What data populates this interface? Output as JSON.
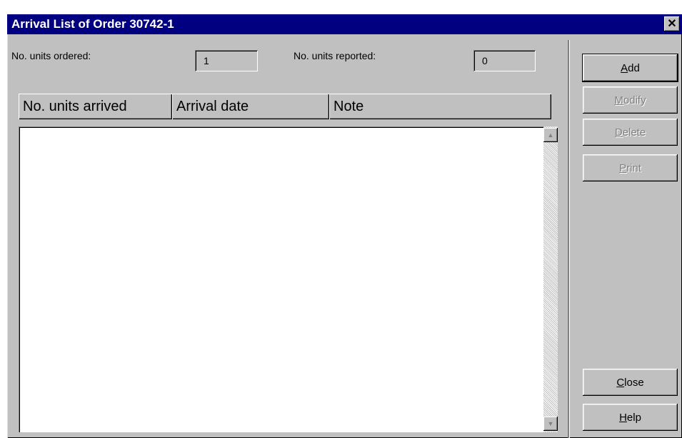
{
  "window": {
    "title": "Arrival List of Order 30742-1",
    "close_glyph": "✕"
  },
  "fields": {
    "units_ordered_label": "No. units ordered:",
    "units_ordered_value": "1",
    "units_reported_label": "No. units reported:",
    "units_reported_value": "0"
  },
  "list": {
    "columns": [
      "No. units arrived",
      "Arrival date",
      "Note"
    ],
    "rows": []
  },
  "scrollbar": {
    "up_glyph": "▲",
    "down_glyph": "▼"
  },
  "buttons": {
    "add": {
      "accel": "A",
      "rest": "dd",
      "enabled": true
    },
    "modify": {
      "accel": "M",
      "rest": "odify",
      "enabled": false
    },
    "delete": {
      "accel": "D",
      "rest": "elete",
      "enabled": false
    },
    "print": {
      "accel": "P",
      "rest": "rint",
      "enabled": false
    },
    "close": {
      "accel": "C",
      "rest": "lose",
      "enabled": true
    },
    "help": {
      "accel": "H",
      "rest": "elp",
      "enabled": true
    }
  },
  "colors": {
    "titlebar": "#000080",
    "face": "#c0c0c0",
    "disabled_text": "#808080"
  }
}
